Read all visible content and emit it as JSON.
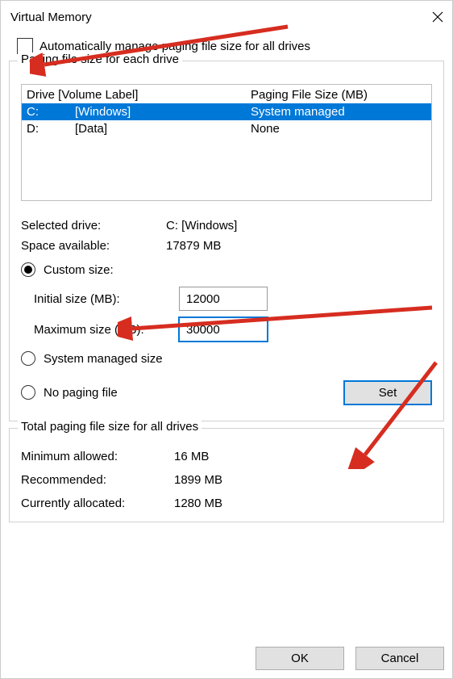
{
  "window": {
    "title": "Virtual Memory"
  },
  "auto_manage": {
    "label": "Automatically manage paging file size for all drives",
    "checked": false
  },
  "drive_section": {
    "legend": "Paging file size for each drive",
    "header_drive": "Drive  [Volume Label]",
    "header_size": "Paging File Size (MB)",
    "rows": [
      {
        "drive": "C:",
        "label": "[Windows]",
        "size": "System managed",
        "selected": true
      },
      {
        "drive": "D:",
        "label": "[Data]",
        "size": "None",
        "selected": false
      }
    ],
    "selected_drive_label": "Selected drive:",
    "selected_drive_value": "C:  [Windows]",
    "space_label": "Space available:",
    "space_value": "17879 MB",
    "custom_size_label": "Custom size:",
    "initial_label": "Initial size (MB):",
    "initial_value": "12000",
    "max_label": "Maximum size (MB):",
    "max_value": "30000",
    "system_managed_label": "System managed size",
    "no_paging_label": "No paging file",
    "set_button": "Set"
  },
  "totals_section": {
    "legend": "Total paging file size for all drives",
    "min_label": "Minimum allowed:",
    "min_value": "16 MB",
    "rec_label": "Recommended:",
    "rec_value": "1899 MB",
    "alloc_label": "Currently allocated:",
    "alloc_value": "1280 MB"
  },
  "buttons": {
    "ok": "OK",
    "cancel": "Cancel"
  }
}
